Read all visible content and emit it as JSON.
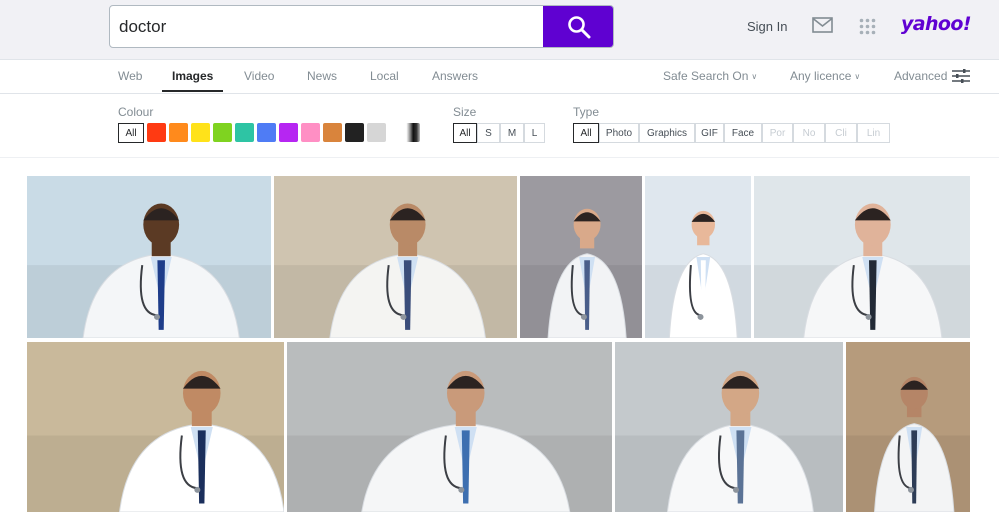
{
  "search": {
    "query": "doctor"
  },
  "header": {
    "sign_in": "Sign In",
    "logo": "yahoo!"
  },
  "tabs": [
    {
      "label": "Web"
    },
    {
      "label": "Images"
    },
    {
      "label": "Video"
    },
    {
      "label": "News"
    },
    {
      "label": "Local"
    },
    {
      "label": "Answers"
    }
  ],
  "tab_options": {
    "safe_search": "Safe Search On",
    "licence": "Any licence",
    "advanced": "Advanced"
  },
  "filters": {
    "colour": {
      "label": "Colour",
      "all_label": "All",
      "swatches": [
        "#ff3a12",
        "#ff8a1c",
        "#ffe21a",
        "#7fd320",
        "#2ec4a4",
        "#4f7cf5",
        "#b626f2",
        "#ff8fc4",
        "#d9843c",
        "#222222",
        "#d6d6d6",
        "#ffffff"
      ]
    },
    "size": {
      "label": "Size",
      "options": [
        "All",
        "S",
        "M",
        "L"
      ]
    },
    "type": {
      "label": "Type",
      "options": [
        "All",
        "Photo",
        "Graphics",
        "GIF",
        "Face",
        "Por",
        "No",
        "Cli",
        "Lin"
      ]
    }
  },
  "results": [
    {
      "name": "doctor-blue-tie-stethoscope",
      "bg": "#c9dbe6",
      "coat": "#f4f6f8",
      "skin": "#5b3a24",
      "tie": "#1e3d8a"
    },
    {
      "name": "doctor-exam-room-folder",
      "bg": "#cfc4b0",
      "coat": "#f4f4f2",
      "skin": "#b98a67",
      "tie": "#3a4d7a"
    },
    {
      "name": "doctor-glasses-grey-backdrop",
      "bg": "#9c9aa0",
      "coat": "#f2f3f5",
      "skin": "#d9a98a",
      "tie": "#4a5e8a"
    },
    {
      "name": "female-doctor-clipboard",
      "bg": "#dfe7ee",
      "coat": "#ffffff",
      "skin": "#e8b89a",
      "tie": "#ffffff"
    },
    {
      "name": "senior-doctor-clipboard",
      "bg": "#dfe6ea",
      "coat": "#f6f7f8",
      "skin": "#e0b39a",
      "tie": "#222a36"
    },
    {
      "name": "doctor-smiling-with-patient",
      "bg": "#c9b99b",
      "coat": "#ffffff",
      "skin": "#c08a64",
      "tie": "#1b2f5c"
    },
    {
      "name": "doctor-consulting-patient",
      "bg": "#b9bcbd",
      "coat": "#f5f6f7",
      "skin": "#c99a7a",
      "tie": "#3d6fb0"
    },
    {
      "name": "doctor-tablet-hospital",
      "bg": "#c4c9cc",
      "coat": "#f7f8f9",
      "skin": "#d3a786",
      "tie": "#5b7396"
    },
    {
      "name": "doctor-leaning-on-desk",
      "bg": "#b69b7c",
      "coat": "#f3f4f5",
      "skin": "#b58567",
      "tie": "#2d3c56"
    }
  ]
}
